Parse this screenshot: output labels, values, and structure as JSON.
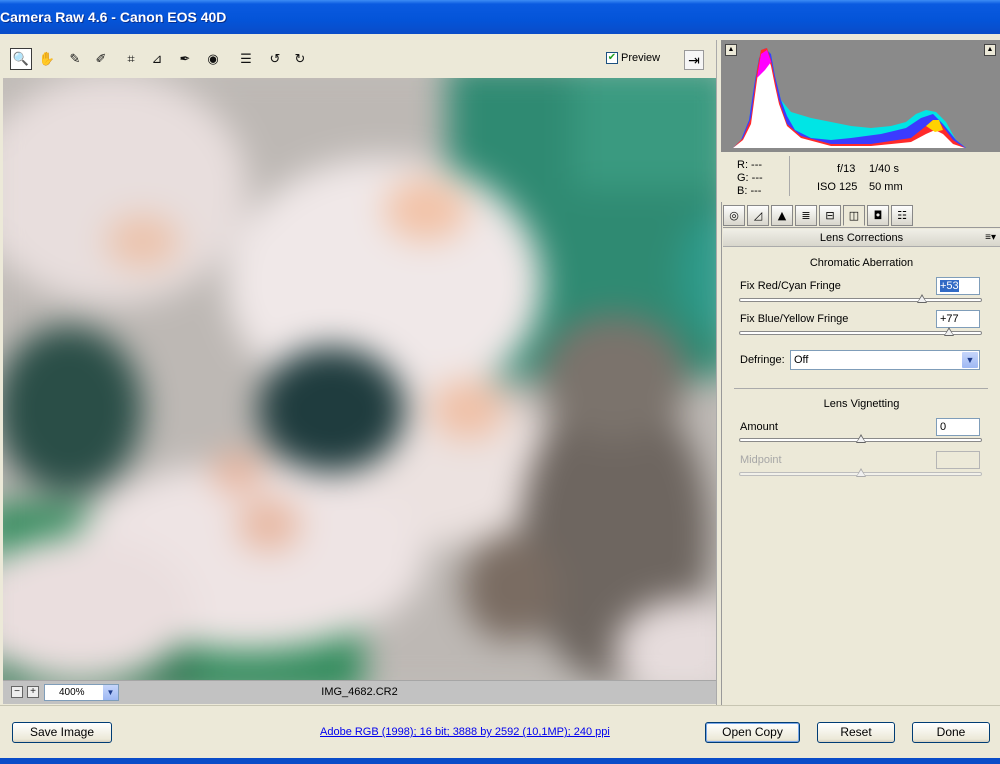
{
  "window": {
    "title": "Camera Raw 4.6  -  Canon EOS 40D"
  },
  "toolbar": {
    "tools": [
      {
        "name": "zoom-tool",
        "icon": "magnifier-icon",
        "glyph": "🔍"
      },
      {
        "name": "hand-tool",
        "icon": "hand-icon",
        "glyph": "✋"
      },
      {
        "name": "white-balance-tool",
        "icon": "eyedropper-icon",
        "glyph": "✎"
      },
      {
        "name": "color-sampler-tool",
        "icon": "color-sampler-icon",
        "glyph": "✐"
      },
      {
        "name": "crop-tool",
        "icon": "crop-icon",
        "glyph": "⌗"
      },
      {
        "name": "straighten-tool",
        "icon": "straighten-icon",
        "glyph": "⊿"
      },
      {
        "name": "retouch-tool",
        "icon": "brush-icon",
        "glyph": "✒"
      },
      {
        "name": "red-eye-tool",
        "icon": "eye-icon",
        "glyph": "◉"
      },
      {
        "name": "preferences-tool",
        "icon": "list-icon",
        "glyph": "☰"
      },
      {
        "name": "rotate-left-tool",
        "icon": "rotate-ccw-icon",
        "glyph": "↺"
      },
      {
        "name": "rotate-right-tool",
        "icon": "rotate-cw-icon",
        "glyph": "↻"
      }
    ],
    "preview_label": "Preview",
    "preview_checked": true
  },
  "status": {
    "zoom": "400%",
    "filename": "IMG_4682.CR2"
  },
  "info": {
    "r": "R:  ---",
    "g": "G:  ---",
    "b": "B:  ---",
    "aperture": "f/13",
    "shutter": "1/40 s",
    "iso": "ISO 125",
    "focal": "50 mm"
  },
  "panel": {
    "tabs": [
      {
        "name": "tab-basic",
        "icon": "aperture-icon",
        "glyph": "◎"
      },
      {
        "name": "tab-tone-curve",
        "icon": "curve-icon",
        "glyph": "◿"
      },
      {
        "name": "tab-detail",
        "icon": "triangle-icon",
        "glyph": "▲"
      },
      {
        "name": "tab-hsl",
        "icon": "bars-icon",
        "glyph": "≣"
      },
      {
        "name": "tab-split-toning",
        "icon": "split-icon",
        "glyph": "⊟"
      },
      {
        "name": "tab-lens-corrections",
        "icon": "lens-icon",
        "glyph": "◫"
      },
      {
        "name": "tab-camera-calibration",
        "icon": "camera-icon",
        "glyph": "◘"
      },
      {
        "name": "tab-presets",
        "icon": "sliders-icon",
        "glyph": "☷"
      }
    ],
    "active_tab": 5,
    "title": "Lens Corrections",
    "chromatic_aberration": {
      "title": "Chromatic Aberration",
      "red_cyan": {
        "label": "Fix Red/Cyan Fringe",
        "value": "+53",
        "amount": 53
      },
      "blue_yellow": {
        "label": "Fix Blue/Yellow Fringe",
        "value": "+77",
        "amount": 77
      },
      "defringe": {
        "label": "Defringe:",
        "value": "Off"
      }
    },
    "vignetting": {
      "title": "Lens Vignetting",
      "amount": {
        "label": "Amount",
        "value": "0",
        "amount": 0
      },
      "midpoint": {
        "label": "Midpoint",
        "value": "",
        "amount": 0
      }
    }
  },
  "footer": {
    "save_label": "Save Image",
    "workflow_link": "Adobe RGB (1998); 16 bit; 3888 by 2592 (10,1MP); 240 ppi",
    "open_label": "Open Copy",
    "reset_label": "Reset",
    "done_label": "Done"
  },
  "colors": {
    "title_bar": "#0454d8",
    "selection": "#316ac5",
    "link": "#0000ee"
  }
}
